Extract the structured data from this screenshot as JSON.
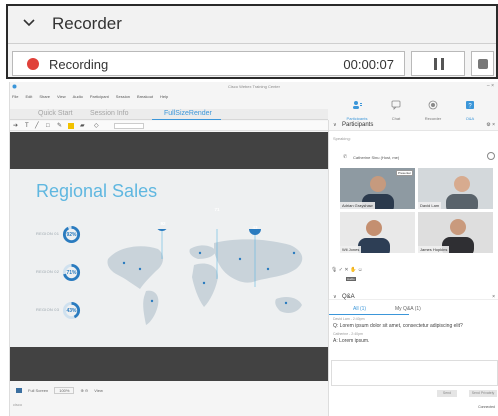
{
  "recorder": {
    "title": "Recorder",
    "status_label": "Recording",
    "elapsed": "00:00:07",
    "recording_color": "#e0413a"
  },
  "app": {
    "window_title": "Cisco Webex Training Center",
    "menu": [
      "File",
      "Edit",
      "Share",
      "View",
      "Audio",
      "Participant",
      "Session",
      "Breakout",
      "Help"
    ],
    "nav": [
      "Participants",
      "Chat",
      "Recorder",
      "Q&A"
    ],
    "tabs": [
      "Quick Start",
      "Session Info",
      "FullSizeRender"
    ],
    "status": [
      "Full Screen",
      "100%",
      "View"
    ],
    "footer_brand": "cisco",
    "connection": "Connected"
  },
  "slide": {
    "title": "Regional Sales",
    "regions": [
      {
        "label": "REGION 01",
        "value": "92%",
        "fraction": 0.92
      },
      {
        "label": "REGION 02",
        "value": "71%",
        "fraction": 0.71
      },
      {
        "label": "REGION 03",
        "value": "43%",
        "fraction": 0.43
      }
    ],
    "pins": [
      "92",
      "71",
      "43"
    ],
    "accent": "#2a7bbf"
  },
  "participants": {
    "title": "Participants",
    "speaking_label": "Speaking:",
    "speaker": "Catherine Sinu (Host, me)",
    "presenter_badge": "Presenter",
    "tiles": [
      "Adrian Grayshaw",
      "David Lam",
      "Wil Jones",
      "James Hopkins"
    ],
    "audio_badge": "Audio"
  },
  "qa": {
    "title": "Q&A",
    "tab_all": "All (1)",
    "tab_mine": "My Q&A (1)",
    "q_meta": "David Lam - 2:40pm",
    "question": "Q: Lorem ipsum dolor sit amet, consectetur adipiscing elit?",
    "a_meta": "Catherine - 2:40pm",
    "answer": "A: Lorem ipsum.",
    "send": "Send",
    "send_all": "Send Privately"
  }
}
